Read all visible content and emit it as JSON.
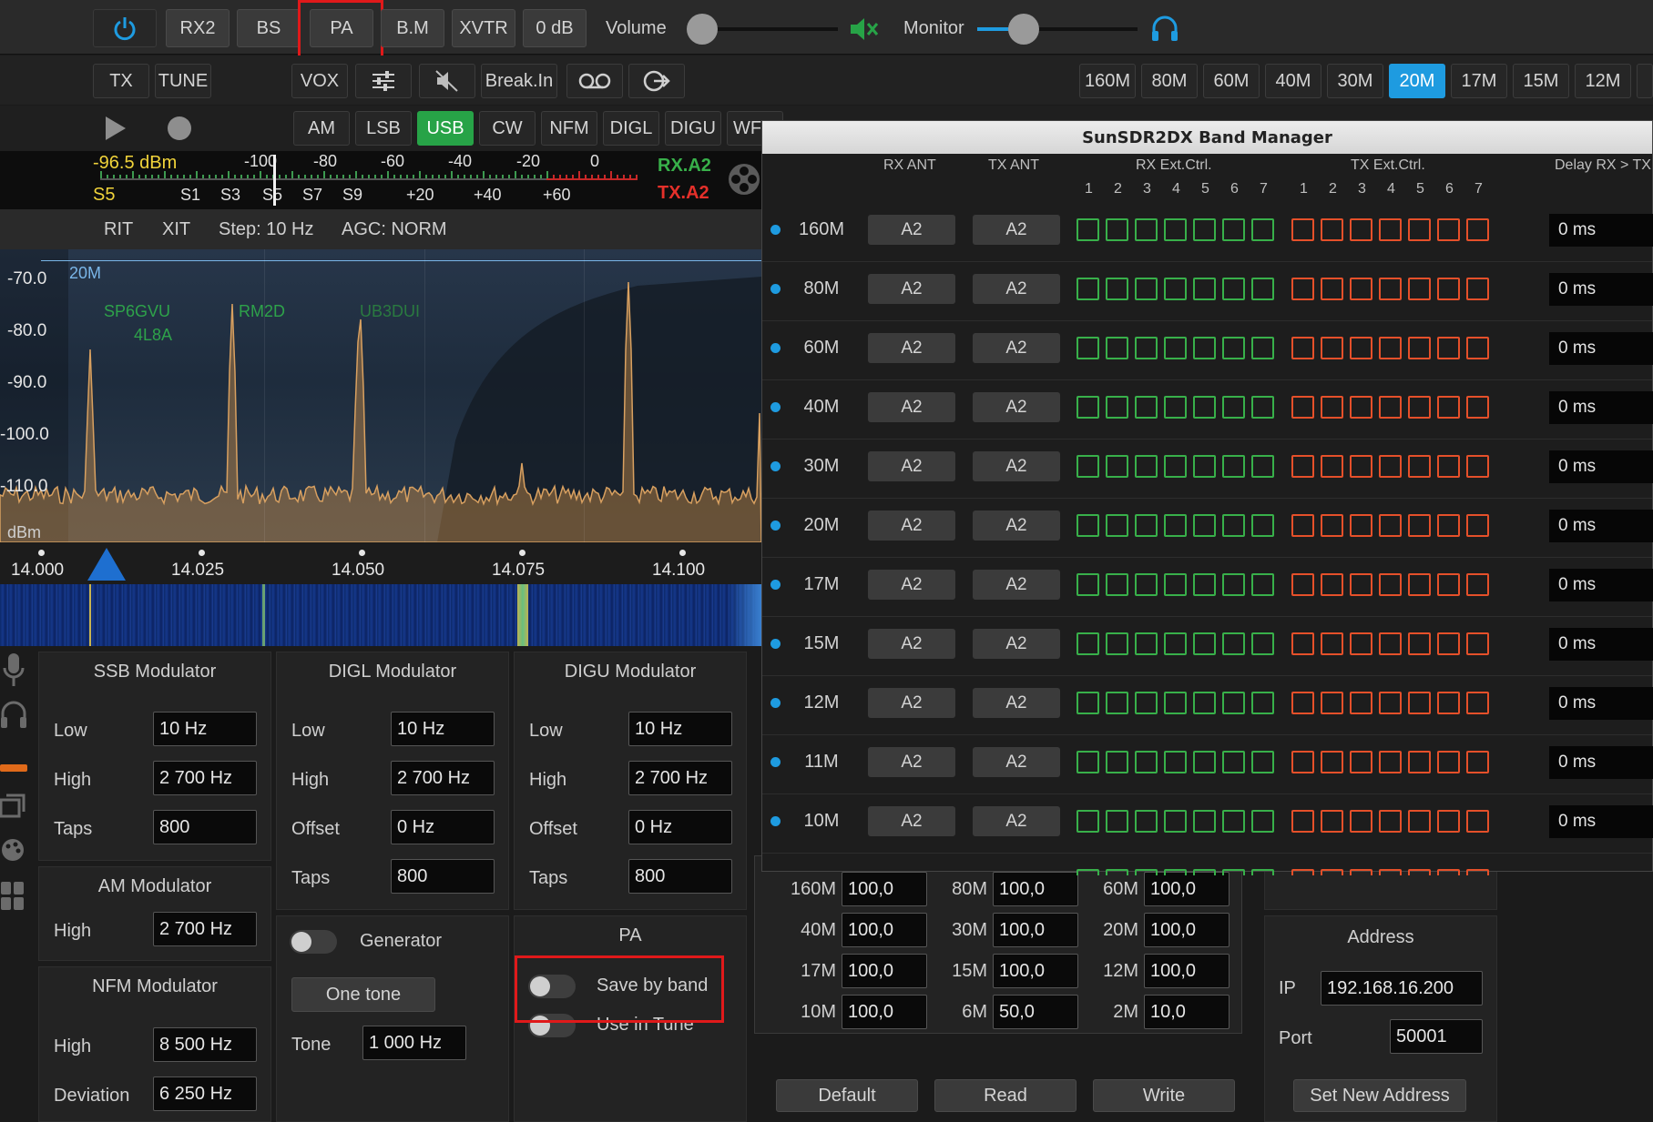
{
  "toolbar1": {
    "rx2": "RX2",
    "bs": "BS",
    "pa": "PA",
    "bm": "B.M",
    "xvtr": "XVTR",
    "att": "0 dB",
    "volume_label": "Volume",
    "monitor_label": "Monitor"
  },
  "toolbar2": {
    "tx": "TX",
    "tune": "TUNE",
    "vox": "VOX",
    "breakin": "Break.In",
    "bands": [
      "160M",
      "80M",
      "60M",
      "40M",
      "30M",
      "20M",
      "17M",
      "15M",
      "12M"
    ],
    "active_band": "20M"
  },
  "modes": {
    "items": [
      "AM",
      "LSB",
      "USB",
      "CW",
      "NFM",
      "DIGL",
      "DIGU",
      "WFM"
    ],
    "active": "USB"
  },
  "smeter": {
    "level": "-96.5 dBm",
    "s_value": "S5",
    "top_scale": [
      "-100",
      "-80",
      "-60",
      "-40",
      "-20",
      "0"
    ],
    "bottom_scale": [
      "S1",
      "S3",
      "S5",
      "S7",
      "S9",
      "+20",
      "+40",
      "+60"
    ],
    "rx_ant": "RX.A2",
    "tx_ant": "TX.A2"
  },
  "status_row": {
    "rit": "RIT",
    "xit": "XIT",
    "step": "Step: 10 Hz",
    "agc": "AGC: NORM"
  },
  "spectrum": {
    "db_labels": [
      "-70.0",
      "-80.0",
      "-90.0",
      "-100.0",
      "-110.0"
    ],
    "unit": "dBm",
    "band_marker": "20M",
    "spots": [
      "SP6GVU",
      "4L8A",
      "RM2D",
      "UB3DUI"
    ],
    "freq_labels": [
      "14.000",
      "14.025",
      "14.050",
      "14.075",
      "14.100"
    ]
  },
  "ssb_mod": {
    "title": "SSB Modulator",
    "low_label": "Low",
    "low": "10 Hz",
    "high_label": "High",
    "high": "2 700 Hz",
    "taps_label": "Taps",
    "taps": "800"
  },
  "digl_mod": {
    "title": "DIGL Modulator",
    "low_label": "Low",
    "low": "10 Hz",
    "high_label": "High",
    "high": "2 700 Hz",
    "offset_label": "Offset",
    "offset": "0 Hz",
    "taps_label": "Taps",
    "taps": "800"
  },
  "digu_mod": {
    "title": "DIGU Modulator",
    "low_label": "Low",
    "low": "10 Hz",
    "high_label": "High",
    "high": "2 700 Hz",
    "offset_label": "Offset",
    "offset": "0 Hz",
    "taps_label": "Taps",
    "taps": "800"
  },
  "am_mod": {
    "title": "AM Modulator",
    "high_label": "High",
    "high": "2 700 Hz"
  },
  "nfm_mod": {
    "title": "NFM Modulator",
    "high_label": "High",
    "high": "8 500 Hz",
    "dev_label": "Deviation",
    "dev": "6 250 Hz"
  },
  "generator": {
    "label": "Generator",
    "one_tone": "One tone",
    "tone_label": "Tone",
    "tone": "1 000 Hz"
  },
  "pa": {
    "title": "PA",
    "save_by_band": "Save by band",
    "use_in_tune": "Use in Tune"
  },
  "power": {
    "rows": [
      [
        {
          "band": "160M",
          "value": "100,0"
        },
        {
          "band": "80M",
          "value": "100,0"
        },
        {
          "band": "60M",
          "value": "100,0"
        }
      ],
      [
        {
          "band": "40M",
          "value": "100,0"
        },
        {
          "band": "30M",
          "value": "100,0"
        },
        {
          "band": "20M",
          "value": "100,0"
        }
      ],
      [
        {
          "band": "17M",
          "value": "100,0"
        },
        {
          "band": "15M",
          "value": "100,0"
        },
        {
          "band": "12M",
          "value": "100,0"
        }
      ],
      [
        {
          "band": "10M",
          "value": "100,0"
        },
        {
          "band": "6M",
          "value": "50,0"
        },
        {
          "band": "2M",
          "value": "10,0"
        }
      ]
    ]
  },
  "actions": {
    "default": "Default",
    "read": "Read",
    "write": "Write"
  },
  "address": {
    "title": "Address",
    "ip_label": "IP",
    "ip": "192.168.16.200",
    "port_label": "Port",
    "port": "50001",
    "set_button": "Set New Address"
  },
  "band_manager": {
    "title": "SunSDR2DX Band Manager",
    "headers": {
      "rx_ant": "RX ANT",
      "tx_ant": "TX ANT",
      "rx_ext": "RX Ext.Ctrl.",
      "tx_ext": "TX Ext.Ctrl.",
      "delay": "Delay RX > TX"
    },
    "ext_numbers": [
      "1",
      "2",
      "3",
      "4",
      "5",
      "6",
      "7"
    ],
    "rows": [
      {
        "band": "160M",
        "rx_ant": "A2",
        "tx_ant": "A2",
        "delay": "0 ms"
      },
      {
        "band": "80M",
        "rx_ant": "A2",
        "tx_ant": "A2",
        "delay": "0 ms"
      },
      {
        "band": "60M",
        "rx_ant": "A2",
        "tx_ant": "A2",
        "delay": "0 ms"
      },
      {
        "band": "40M",
        "rx_ant": "A2",
        "tx_ant": "A2",
        "delay": "0 ms"
      },
      {
        "band": "30M",
        "rx_ant": "A2",
        "tx_ant": "A2",
        "delay": "0 ms"
      },
      {
        "band": "20M",
        "rx_ant": "A2",
        "tx_ant": "A2",
        "delay": "0 ms"
      },
      {
        "band": "17M",
        "rx_ant": "A2",
        "tx_ant": "A2",
        "delay": "0 ms"
      },
      {
        "band": "15M",
        "rx_ant": "A2",
        "tx_ant": "A2",
        "delay": "0 ms"
      },
      {
        "band": "12M",
        "rx_ant": "A2",
        "tx_ant": "A2",
        "delay": "0 ms"
      },
      {
        "band": "11M",
        "rx_ant": "A2",
        "tx_ant": "A2",
        "delay": "0 ms"
      },
      {
        "band": "10M",
        "rx_ant": "A2",
        "tx_ant": "A2",
        "delay": "0 ms"
      }
    ]
  },
  "colors": {
    "accent": "#1e9be0",
    "active_mode": "#27a347",
    "highlight": "#e0191a",
    "rx_ext": "#38b04a",
    "tx_ext": "#e5502a"
  },
  "icons": [
    "power-icon",
    "speaker-muted-icon",
    "headphones-icon",
    "equalizer-icon",
    "mute-icon",
    "record-tape-icon",
    "exit-icon",
    "play-icon",
    "record-icon",
    "reel-icon",
    "mic-icon",
    "headset-icon",
    "window-icon",
    "palette-icon",
    "grid-icon"
  ]
}
